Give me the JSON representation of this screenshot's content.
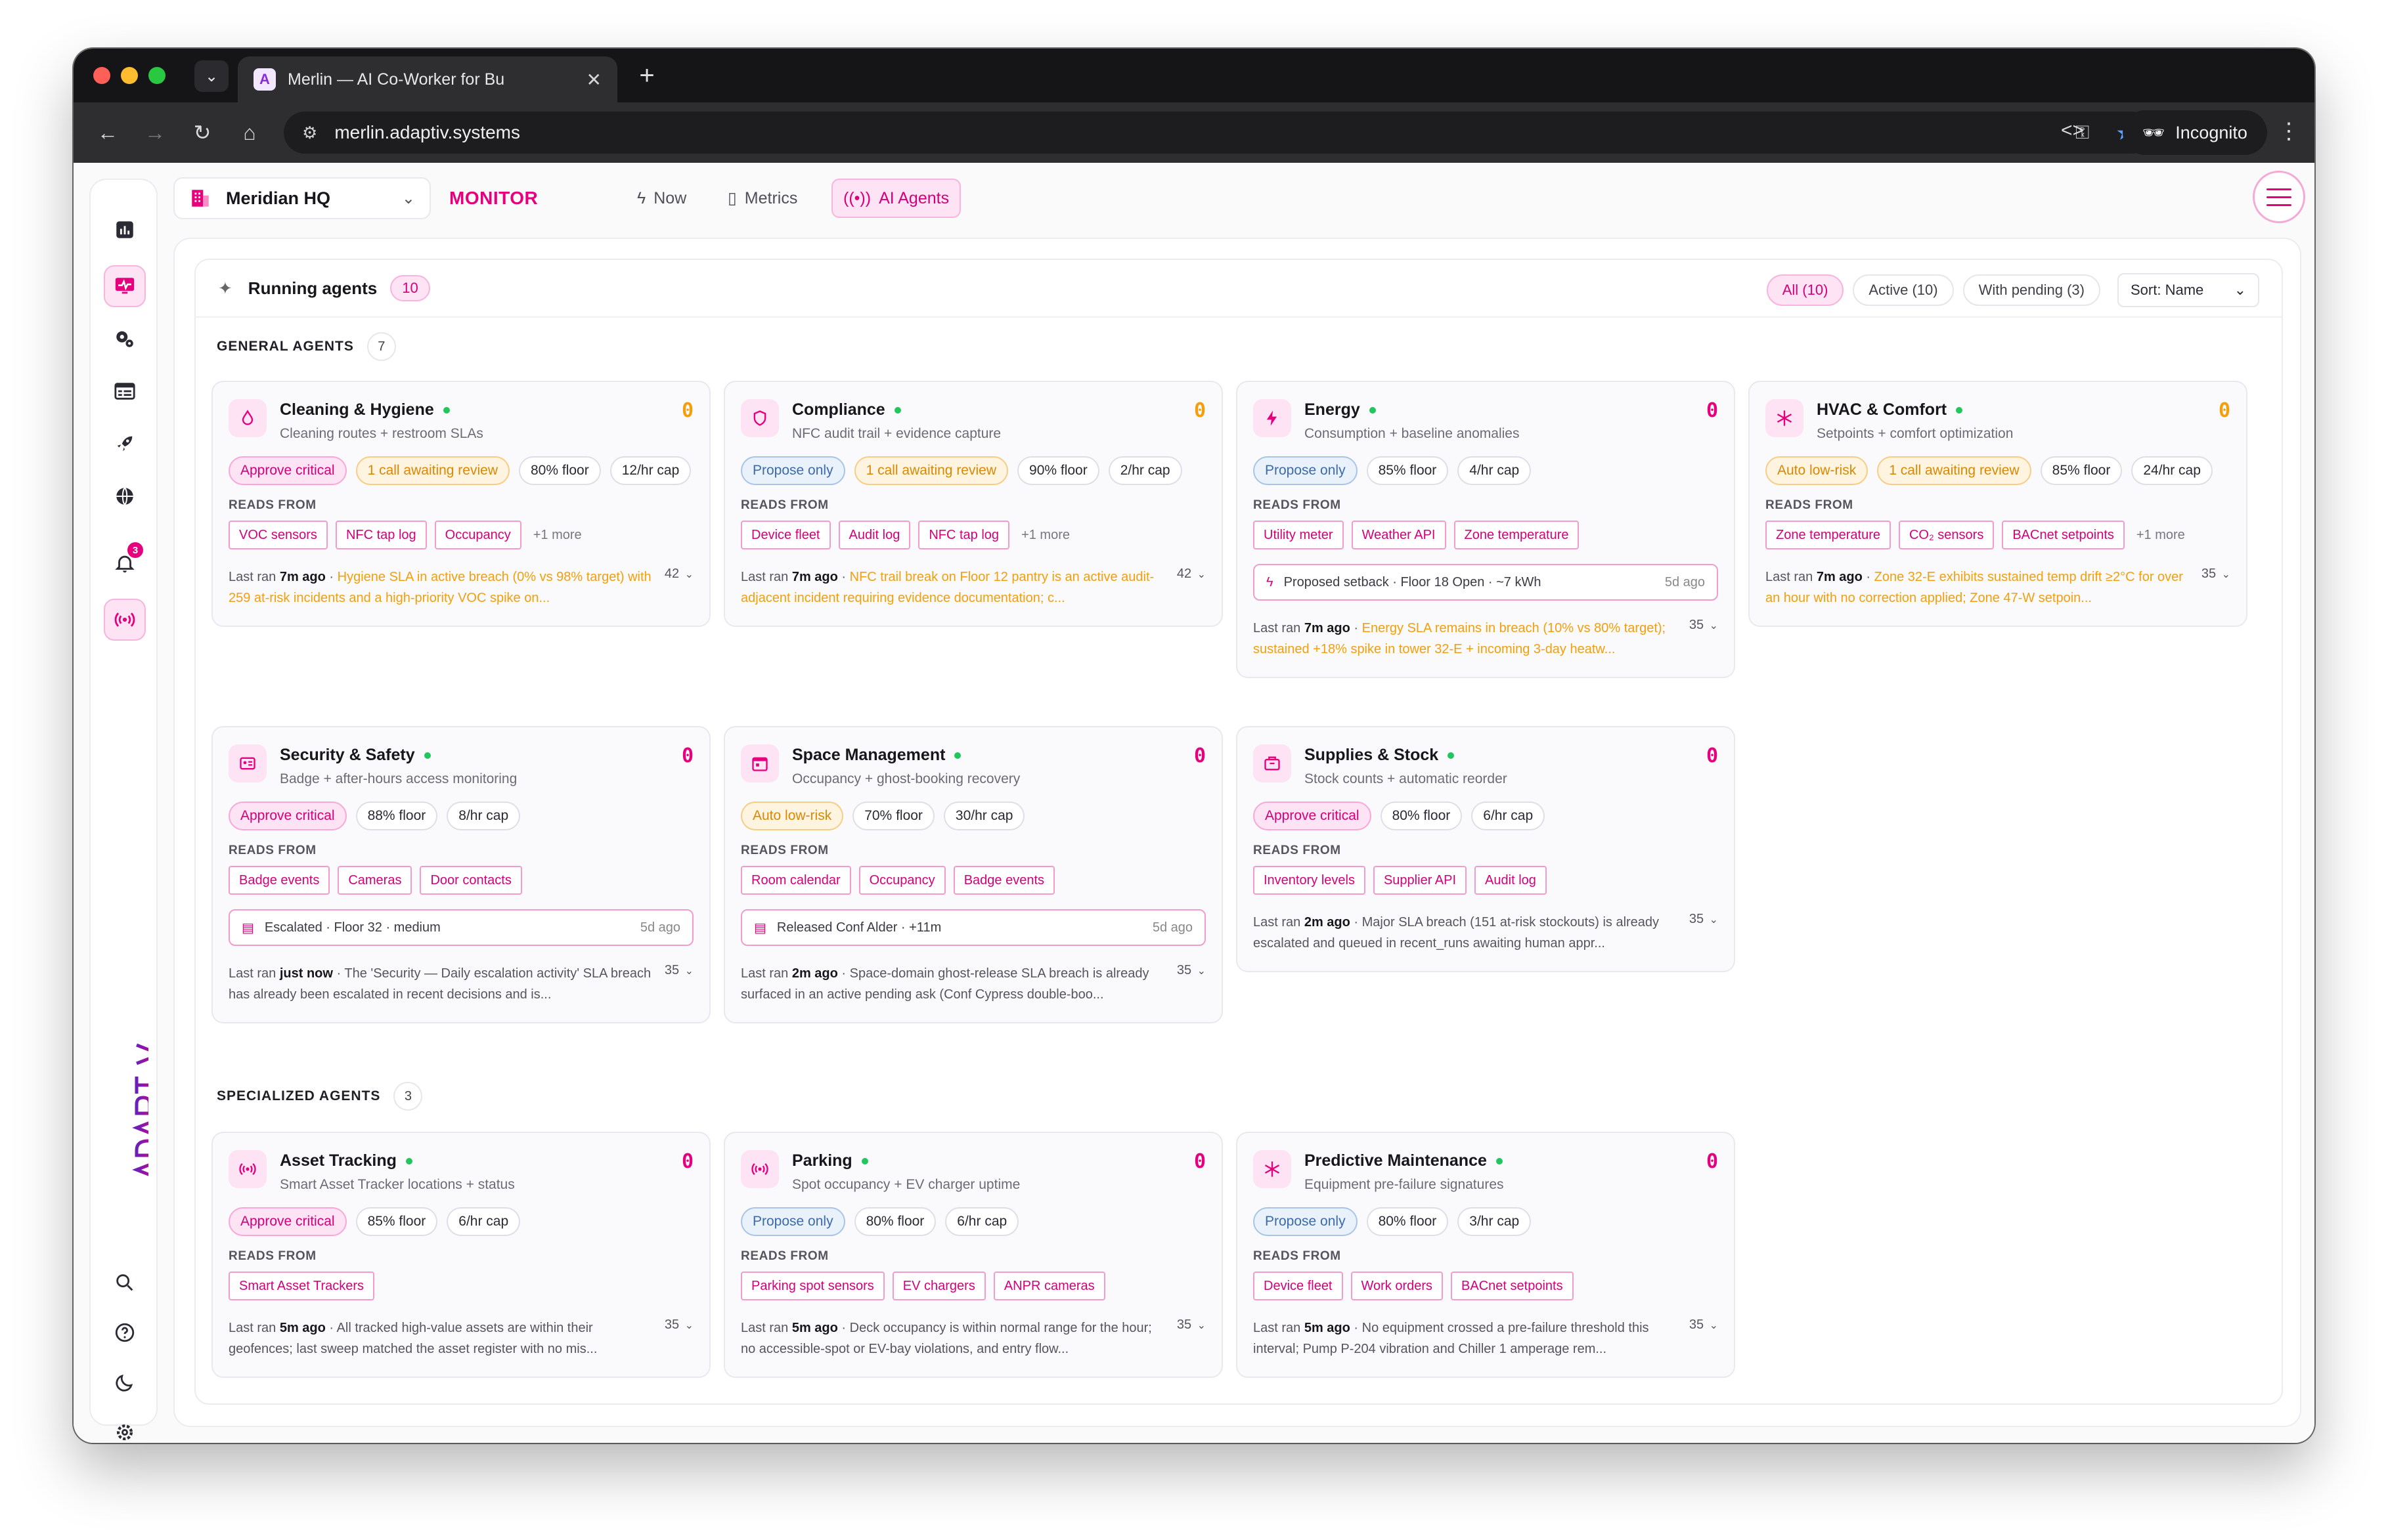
{
  "browser": {
    "tab_title": "Merlin — AI Co-Worker for Bu",
    "url": "merlin.adaptiv.systems",
    "incognito_label": "Incognito"
  },
  "rail": {
    "notifications_count": "3",
    "logo_text": "ADAPTIV"
  },
  "topbar": {
    "site_name": "Meridian HQ",
    "monitor_label": "MONITOR",
    "nav_now": "Now",
    "nav_metrics": "Metrics",
    "nav_ai_agents": "AI Agents"
  },
  "panel": {
    "title": "Running agents",
    "count": "10",
    "filters": {
      "all": "All (10)",
      "active": "Active (10)",
      "pending": "With pending (3)"
    },
    "sort": "Sort: Name"
  },
  "sections": {
    "general": {
      "label": "GENERAL AGENTS",
      "count": "7"
    },
    "specialized": {
      "label": "SPECIALIZED AGENTS",
      "count": "3"
    }
  },
  "reads_label": "READS FROM",
  "last_ran_label": "Last ran",
  "agents": [
    {
      "name": "Cleaning & Hygiene",
      "desc": "Cleaning routes + restroom SLAs",
      "pending": "0",
      "pending_color": "orange",
      "icon": "droplet-icon",
      "chips": [
        {
          "text": "Approve critical",
          "kind": "critical"
        },
        {
          "text": "1 call awaiting review",
          "kind": "review"
        },
        {
          "text": "80% floor",
          "kind": "plain"
        },
        {
          "text": "12/hr cap",
          "kind": "plain"
        }
      ],
      "sources": [
        "VOC sensors",
        "NFC tap log",
        "Occupancy"
      ],
      "more": "+1 more",
      "last_ago": "7m ago",
      "summary": "Hygiene SLA in active breach (0% vs 98% target) with 259 at-risk incidents and a high-priority VOC spike on...",
      "summary_hi": true,
      "runs": "42"
    },
    {
      "name": "Compliance",
      "desc": "NFC audit trail + evidence capture",
      "pending": "0",
      "pending_color": "orange",
      "icon": "shield-icon",
      "chips": [
        {
          "text": "Propose only",
          "kind": "propose"
        },
        {
          "text": "1 call awaiting review",
          "kind": "review"
        },
        {
          "text": "90% floor",
          "kind": "plain"
        },
        {
          "text": "2/hr cap",
          "kind": "plain"
        }
      ],
      "sources": [
        "Device fleet",
        "Audit log",
        "NFC tap log"
      ],
      "more": "+1 more",
      "last_ago": "7m ago",
      "summary": "NFC trail break on Floor 12 pantry is an active audit-adjacent incident requiring evidence documentation; c...",
      "summary_hi": true,
      "runs": "42"
    },
    {
      "name": "Energy",
      "desc": "Consumption + baseline anomalies",
      "pending": "0",
      "pending_color": "pink",
      "icon": "bolt-icon",
      "chips": [
        {
          "text": "Propose only",
          "kind": "propose"
        },
        {
          "text": "85% floor",
          "kind": "plain"
        },
        {
          "text": "4/hr cap",
          "kind": "plain"
        }
      ],
      "sources": [
        "Utility meter",
        "Weather API",
        "Zone temperature"
      ],
      "more": "",
      "pending_item": {
        "text": "Proposed setback · Floor 18 Open · ~7 kWh",
        "age": "5d ago"
      },
      "last_ago": "7m ago",
      "summary": "Energy SLA remains in breach (10% vs 80% target); sustained +18% spike in tower 32-E + incoming 3-day heatw...",
      "summary_hi": true,
      "runs": "35"
    },
    {
      "name": "HVAC & Comfort",
      "desc": "Setpoints + comfort optimization",
      "pending": "0",
      "pending_color": "orange",
      "icon": "snowflake-icon",
      "chips": [
        {
          "text": "Auto low-risk",
          "kind": "auto"
        },
        {
          "text": "1 call awaiting review",
          "kind": "review"
        },
        {
          "text": "85% floor",
          "kind": "plain"
        },
        {
          "text": "24/hr cap",
          "kind": "plain"
        }
      ],
      "sources": [
        "Zone temperature",
        "CO₂ sensors",
        "BACnet setpoints"
      ],
      "more": "+1 more",
      "last_ago": "7m ago",
      "summary": "Zone 32-E exhibits sustained temp drift ≥2°C for over an hour with no correction applied; Zone 47-W setpoin...",
      "summary_hi": true,
      "runs": "35"
    },
    {
      "name": "Security & Safety",
      "desc": "Badge + after-hours access monitoring",
      "pending": "0",
      "pending_color": "pink",
      "icon": "badge-icon",
      "chips": [
        {
          "text": "Approve critical",
          "kind": "critical"
        },
        {
          "text": "88% floor",
          "kind": "plain"
        },
        {
          "text": "8/hr cap",
          "kind": "plain"
        }
      ],
      "sources": [
        "Badge events",
        "Cameras",
        "Door contacts"
      ],
      "more": "",
      "pending_item": {
        "text": "Escalated · Floor 32 · medium",
        "age": "5d ago"
      },
      "last_ago": "just now",
      "summary": "The 'Security — Daily escalation activity' SLA breach has already been escalated in recent decisions and is...",
      "summary_hi": false,
      "runs": "35"
    },
    {
      "name": "Space Management",
      "desc": "Occupancy + ghost-booking recovery",
      "pending": "0",
      "pending_color": "pink",
      "icon": "calendar-icon",
      "chips": [
        {
          "text": "Auto low-risk",
          "kind": "auto"
        },
        {
          "text": "70% floor",
          "kind": "plain"
        },
        {
          "text": "30/hr cap",
          "kind": "plain"
        }
      ],
      "sources": [
        "Room calendar",
        "Occupancy",
        "Badge events"
      ],
      "more": "",
      "pending_item": {
        "text": "Released Conf Alder · +11m",
        "age": "5d ago"
      },
      "last_ago": "2m ago",
      "summary": "Space-domain ghost-release SLA breach is already surfaced in an active pending ask (Conf Cypress double-boo...",
      "summary_hi": false,
      "runs": "35"
    },
    {
      "name": "Supplies & Stock",
      "desc": "Stock counts + automatic reorder",
      "pending": "0",
      "pending_color": "pink",
      "icon": "box-icon",
      "chips": [
        {
          "text": "Approve critical",
          "kind": "critical"
        },
        {
          "text": "80% floor",
          "kind": "plain"
        },
        {
          "text": "6/hr cap",
          "kind": "plain"
        }
      ],
      "sources": [
        "Inventory levels",
        "Supplier API",
        "Audit log"
      ],
      "more": "",
      "last_ago": "2m ago",
      "summary": "Major SLA breach (151 at-risk stockouts) is already escalated and queued in recent_runs awaiting human appr...",
      "summary_hi": false,
      "runs": "35"
    },
    {
      "name": "Asset Tracking",
      "desc": "Smart Asset Tracker locations + status",
      "pending": "0",
      "pending_color": "pink",
      "icon": "broadcast-icon",
      "chips": [
        {
          "text": "Approve critical",
          "kind": "critical"
        },
        {
          "text": "85% floor",
          "kind": "plain"
        },
        {
          "text": "6/hr cap",
          "kind": "plain"
        }
      ],
      "sources": [
        "Smart Asset Trackers"
      ],
      "more": "",
      "last_ago": "5m ago",
      "summary": "All tracked high-value assets are within their geofences; last sweep matched the asset register with no mis...",
      "summary_hi": false,
      "runs": "35"
    },
    {
      "name": "Parking",
      "desc": "Spot occupancy + EV charger uptime",
      "pending": "0",
      "pending_color": "pink",
      "icon": "broadcast-icon",
      "chips": [
        {
          "text": "Propose only",
          "kind": "propose"
        },
        {
          "text": "80% floor",
          "kind": "plain"
        },
        {
          "text": "6/hr cap",
          "kind": "plain"
        }
      ],
      "sources": [
        "Parking spot sensors",
        "EV chargers",
        "ANPR cameras"
      ],
      "more": "",
      "last_ago": "5m ago",
      "summary": "Deck occupancy is within normal range for the hour; no accessible-spot or EV-bay violations, and entry flow...",
      "summary_hi": false,
      "runs": "35"
    },
    {
      "name": "Predictive Maintenance",
      "desc": "Equipment pre-failure signatures",
      "pending": "0",
      "pending_color": "pink",
      "icon": "snowflake-icon",
      "chips": [
        {
          "text": "Propose only",
          "kind": "propose"
        },
        {
          "text": "80% floor",
          "kind": "plain"
        },
        {
          "text": "3/hr cap",
          "kind": "plain"
        }
      ],
      "sources": [
        "Device fleet",
        "Work orders",
        "BACnet setpoints"
      ],
      "more": "",
      "last_ago": "5m ago",
      "summary": "No equipment crossed a pre-failure threshold this interval; Pump P-204 vibration and Chiller 1 amperage rem...",
      "summary_hi": false,
      "runs": "35"
    }
  ]
}
